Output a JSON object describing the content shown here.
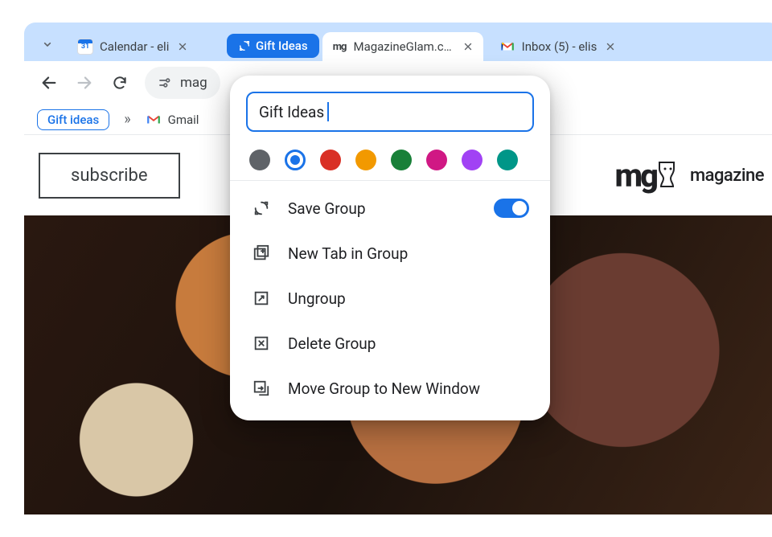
{
  "tabs": {
    "dropdown_tooltip": "Search tabs",
    "group_chip": {
      "label": "Gift Ideas"
    },
    "items": [
      {
        "title": "Calendar - eli",
        "favicon": "calendar"
      },
      {
        "title": "MagazineGlam.com",
        "favicon": "mg"
      },
      {
        "title": "Inbox (5) - elis",
        "favicon": "gmail"
      }
    ]
  },
  "toolbar": {
    "omnibox_text": "mag"
  },
  "bookmarks": {
    "chip": "Gift ideas",
    "gmail_label": "Gmail"
  },
  "page": {
    "subscribe_label": "subscribe",
    "brand_logo": "mg",
    "brand_text": "magazine"
  },
  "group_menu": {
    "name_value": "Gift Ideas",
    "colors": [
      "#5f6368",
      "#1a73e8",
      "#d93025",
      "#f29900",
      "#188038",
      "#d01884",
      "#a142f4",
      "#009688"
    ],
    "selected_color_index": 1,
    "rows": {
      "save": "Save Group",
      "save_toggle_on": true,
      "new_tab": "New Tab in Group",
      "ungroup": "Ungroup",
      "delete": "Delete Group",
      "move": "Move Group to New Window"
    }
  }
}
